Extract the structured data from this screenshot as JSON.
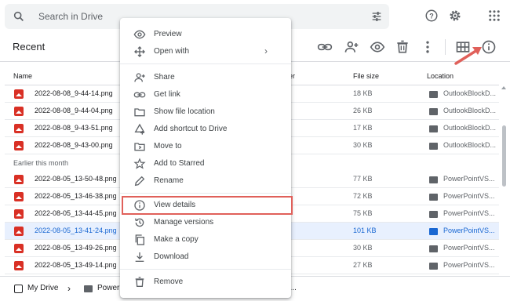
{
  "search": {
    "placeholder": "Search in Drive"
  },
  "view": {
    "title": "Recent"
  },
  "columns": {
    "name": "Name",
    "owner_partial": "er",
    "file_size": "File size",
    "location": "Location"
  },
  "files_top": [
    {
      "name": "2022-08-08_9-44-14.png",
      "size": "18 KB",
      "location": "OutlookBlockD..."
    },
    {
      "name": "2022-08-08_9-44-04.png",
      "size": "26 KB",
      "location": "OutlookBlockD..."
    },
    {
      "name": "2022-08-08_9-43-51.png",
      "size": "17 KB",
      "location": "OutlookBlockD..."
    },
    {
      "name": "2022-08-08_9-43-00.png",
      "size": "30 KB",
      "location": "OutlookBlockD..."
    }
  ],
  "section_label": "Earlier this month",
  "files_month": [
    {
      "name": "2022-08-05_13-50-48.png",
      "size": "77 KB",
      "location": "PowerPointVS..."
    },
    {
      "name": "2022-08-05_13-46-38.png",
      "size": "72 KB",
      "location": "PowerPointVS..."
    },
    {
      "name": "2022-08-05_13-44-45.png",
      "size": "75 KB",
      "location": "PowerPointVS..."
    },
    {
      "name": "2022-08-05_13-41-24.png",
      "size": "101 KB",
      "location": "PowerPointVS..."
    },
    {
      "name": "2022-08-05_13-49-26.png",
      "size": "30 KB",
      "location": "PowerPointVS..."
    },
    {
      "name": "2022-08-05_13-49-14.png",
      "size": "27 KB",
      "location": "PowerPointVS..."
    }
  ],
  "selected_row_index": 3,
  "breadcrumb": {
    "root": "My Drive",
    "folder_partial": "Powerl",
    "tail": "4..."
  },
  "menu": {
    "preview": "Preview",
    "open_with": "Open with",
    "share": "Share",
    "get_link": "Get link",
    "show_location": "Show file location",
    "add_shortcut": "Add shortcut to Drive",
    "move_to": "Move to",
    "add_starred": "Add to Starred",
    "rename": "Rename",
    "view_details": "View details",
    "manage_versions": "Manage versions",
    "make_copy": "Make a copy",
    "download": "Download",
    "remove": "Remove"
  },
  "colors": {
    "accent_blue": "#1967d2",
    "selected_bg": "#e8f0fe",
    "file_red": "#d93025",
    "annotation": "#e0605a"
  },
  "icons": [
    "search-icon",
    "tune-icon",
    "help-icon",
    "gear-icon",
    "apps-grid-icon",
    "link-icon",
    "add-person-icon",
    "eye-icon",
    "trash-icon",
    "more-vert-icon",
    "grid-view-icon",
    "info-icon"
  ]
}
